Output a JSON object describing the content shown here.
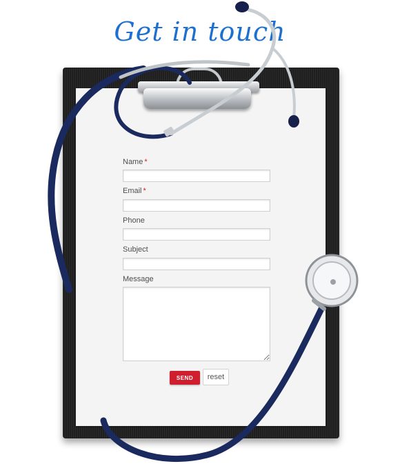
{
  "page": {
    "heading": "Get in touch"
  },
  "form": {
    "required_marker": "*",
    "fields": [
      {
        "label": "Name",
        "required": true,
        "value": ""
      },
      {
        "label": "Email",
        "required": true,
        "value": ""
      },
      {
        "label": "Phone",
        "required": false,
        "value": ""
      },
      {
        "label": "Subject",
        "required": false,
        "value": ""
      },
      {
        "label": "Message",
        "required": false,
        "value": ""
      }
    ],
    "send_label": "SEND",
    "reset_label": "reset"
  },
  "colors": {
    "heading": "#1d6fd0",
    "send_button": "#cf1e2d",
    "required_marker": "#d11a2a",
    "stethoscope_tube": "#1a2a5e",
    "clipboard_board": "#1f1f1f"
  },
  "icons": {
    "decoration": "stethoscope-icon",
    "board": "clipboard-icon"
  }
}
